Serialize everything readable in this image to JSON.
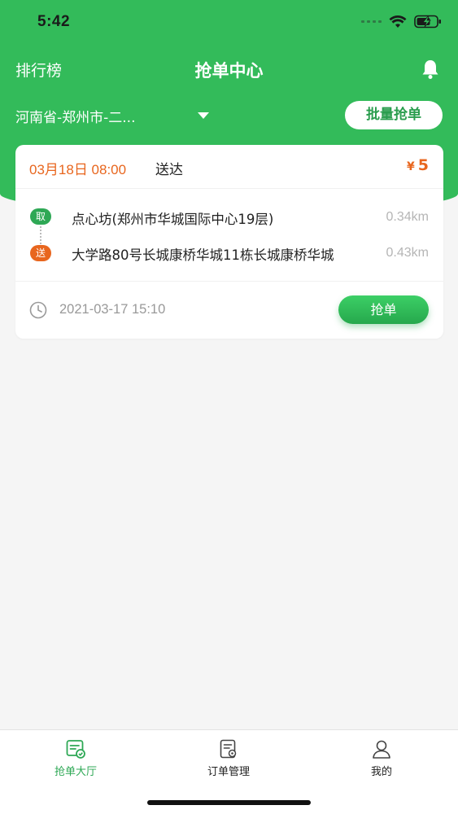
{
  "status_bar": {
    "time": "5:42"
  },
  "nav": {
    "left_label": "排行榜",
    "title": "抢单中心"
  },
  "filter": {
    "region": "河南省-郑州市-二...",
    "batch_button": "批量抢单"
  },
  "order": {
    "delivery_time": "03月18日 08:00",
    "delivery_label": "送达",
    "currency": "¥",
    "price": "5",
    "pickup": {
      "badge": "取",
      "address": "点心坊(郑州市华城国际中心19层)",
      "distance": "0.34km"
    },
    "dropoff": {
      "badge": "送",
      "address": "大学路80号长城康桥华城11栋长城康桥华城",
      "distance": "0.43km"
    },
    "order_time": "2021-03-17 15:10",
    "grab_button": "抢单"
  },
  "tabs": [
    {
      "label": "抢单大厅",
      "icon": "grab-hall-icon",
      "active": true
    },
    {
      "label": "订单管理",
      "icon": "order-manage-icon",
      "active": false
    },
    {
      "label": "我的",
      "icon": "profile-icon",
      "active": false
    }
  ],
  "colors": {
    "brand_green": "#33bb5a",
    "accent_orange": "#e8661e",
    "muted_gray": "#999999",
    "background": "#f5f5f5"
  }
}
